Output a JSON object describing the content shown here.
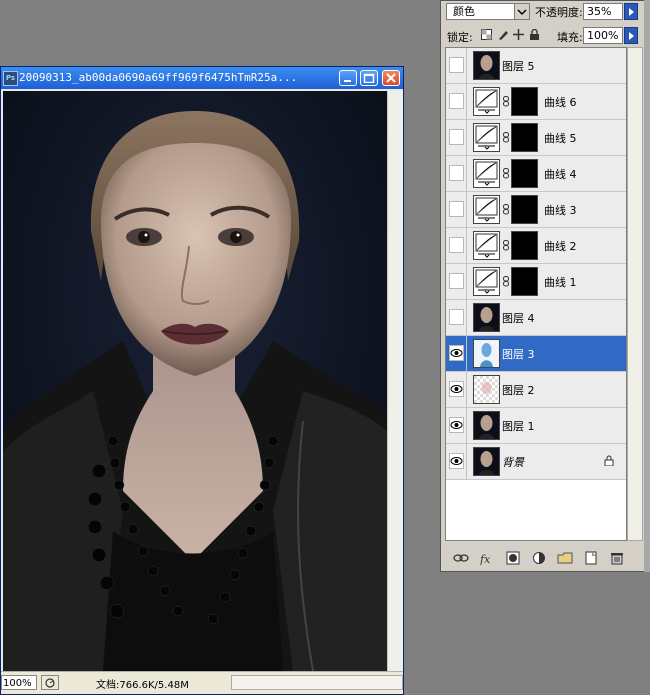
{
  "image_window": {
    "title": "20090313_ab00da0690a69ff969f6475hTmR25a...",
    "app_icon": "Ps",
    "zoom": "100%",
    "doc_info": "文档:766.6K/5.48M"
  },
  "layers_panel": {
    "blend_mode": "颜色",
    "opacity_label": "不透明度:",
    "opacity_value": "35%",
    "lock_label": "锁定:",
    "fill_label": "填充:",
    "fill_value": "100%",
    "layers": [
      {
        "name": "图层 5",
        "visible": false,
        "kind": "portrait",
        "selected": false
      },
      {
        "name": "曲线 6",
        "visible": false,
        "kind": "curves",
        "selected": false
      },
      {
        "name": "曲线 5",
        "visible": false,
        "kind": "curves",
        "selected": false
      },
      {
        "name": "曲线 4",
        "visible": false,
        "kind": "curves",
        "selected": false
      },
      {
        "name": "曲线 3",
        "visible": false,
        "kind": "curves",
        "selected": false
      },
      {
        "name": "曲线 2",
        "visible": false,
        "kind": "curves",
        "selected": false
      },
      {
        "name": "曲线 1",
        "visible": false,
        "kind": "curves",
        "selected": false
      },
      {
        "name": "图层 4",
        "visible": false,
        "kind": "portrait",
        "selected": false
      },
      {
        "name": "图层 3",
        "visible": true,
        "kind": "blue",
        "selected": true
      },
      {
        "name": "图层 2",
        "visible": true,
        "kind": "transparent",
        "selected": false
      },
      {
        "name": "图层 1",
        "visible": true,
        "kind": "portrait",
        "selected": false
      },
      {
        "name": "背景",
        "visible": true,
        "kind": "portrait",
        "selected": false,
        "locked": true
      }
    ],
    "footer_icons": [
      "link-icon",
      "fx-icon",
      "mask-icon",
      "adjustment-icon",
      "folder-icon",
      "new-layer-icon",
      "trash-icon"
    ]
  },
  "colors": {
    "title_bar": "#2a6ee0",
    "selection": "#316ac5",
    "workspace": "#808080"
  }
}
